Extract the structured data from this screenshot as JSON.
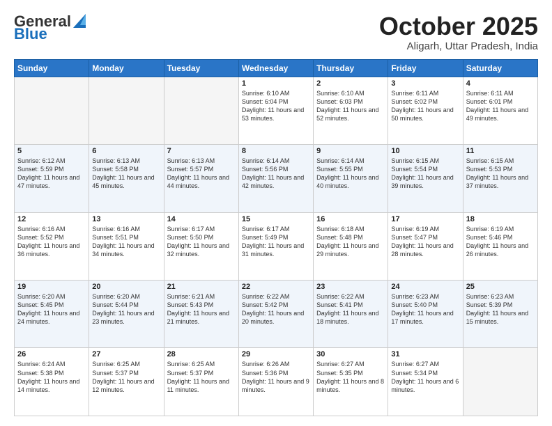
{
  "header": {
    "logo_general": "General",
    "logo_blue": "Blue",
    "month_title": "October 2025",
    "location": "Aligarh, Uttar Pradesh, India"
  },
  "days_of_week": [
    "Sunday",
    "Monday",
    "Tuesday",
    "Wednesday",
    "Thursday",
    "Friday",
    "Saturday"
  ],
  "weeks": [
    [
      {
        "day": "",
        "sunrise": "",
        "sunset": "",
        "daylight": ""
      },
      {
        "day": "",
        "sunrise": "",
        "sunset": "",
        "daylight": ""
      },
      {
        "day": "",
        "sunrise": "",
        "sunset": "",
        "daylight": ""
      },
      {
        "day": "1",
        "sunrise": "Sunrise: 6:10 AM",
        "sunset": "Sunset: 6:04 PM",
        "daylight": "Daylight: 11 hours and 53 minutes."
      },
      {
        "day": "2",
        "sunrise": "Sunrise: 6:10 AM",
        "sunset": "Sunset: 6:03 PM",
        "daylight": "Daylight: 11 hours and 52 minutes."
      },
      {
        "day": "3",
        "sunrise": "Sunrise: 6:11 AM",
        "sunset": "Sunset: 6:02 PM",
        "daylight": "Daylight: 11 hours and 50 minutes."
      },
      {
        "day": "4",
        "sunrise": "Sunrise: 6:11 AM",
        "sunset": "Sunset: 6:01 PM",
        "daylight": "Daylight: 11 hours and 49 minutes."
      }
    ],
    [
      {
        "day": "5",
        "sunrise": "Sunrise: 6:12 AM",
        "sunset": "Sunset: 5:59 PM",
        "daylight": "Daylight: 11 hours and 47 minutes."
      },
      {
        "day": "6",
        "sunrise": "Sunrise: 6:13 AM",
        "sunset": "Sunset: 5:58 PM",
        "daylight": "Daylight: 11 hours and 45 minutes."
      },
      {
        "day": "7",
        "sunrise": "Sunrise: 6:13 AM",
        "sunset": "Sunset: 5:57 PM",
        "daylight": "Daylight: 11 hours and 44 minutes."
      },
      {
        "day": "8",
        "sunrise": "Sunrise: 6:14 AM",
        "sunset": "Sunset: 5:56 PM",
        "daylight": "Daylight: 11 hours and 42 minutes."
      },
      {
        "day": "9",
        "sunrise": "Sunrise: 6:14 AM",
        "sunset": "Sunset: 5:55 PM",
        "daylight": "Daylight: 11 hours and 40 minutes."
      },
      {
        "day": "10",
        "sunrise": "Sunrise: 6:15 AM",
        "sunset": "Sunset: 5:54 PM",
        "daylight": "Daylight: 11 hours and 39 minutes."
      },
      {
        "day": "11",
        "sunrise": "Sunrise: 6:15 AM",
        "sunset": "Sunset: 5:53 PM",
        "daylight": "Daylight: 11 hours and 37 minutes."
      }
    ],
    [
      {
        "day": "12",
        "sunrise": "Sunrise: 6:16 AM",
        "sunset": "Sunset: 5:52 PM",
        "daylight": "Daylight: 11 hours and 36 minutes."
      },
      {
        "day": "13",
        "sunrise": "Sunrise: 6:16 AM",
        "sunset": "Sunset: 5:51 PM",
        "daylight": "Daylight: 11 hours and 34 minutes."
      },
      {
        "day": "14",
        "sunrise": "Sunrise: 6:17 AM",
        "sunset": "Sunset: 5:50 PM",
        "daylight": "Daylight: 11 hours and 32 minutes."
      },
      {
        "day": "15",
        "sunrise": "Sunrise: 6:17 AM",
        "sunset": "Sunset: 5:49 PM",
        "daylight": "Daylight: 11 hours and 31 minutes."
      },
      {
        "day": "16",
        "sunrise": "Sunrise: 6:18 AM",
        "sunset": "Sunset: 5:48 PM",
        "daylight": "Daylight: 11 hours and 29 minutes."
      },
      {
        "day": "17",
        "sunrise": "Sunrise: 6:19 AM",
        "sunset": "Sunset: 5:47 PM",
        "daylight": "Daylight: 11 hours and 28 minutes."
      },
      {
        "day": "18",
        "sunrise": "Sunrise: 6:19 AM",
        "sunset": "Sunset: 5:46 PM",
        "daylight": "Daylight: 11 hours and 26 minutes."
      }
    ],
    [
      {
        "day": "19",
        "sunrise": "Sunrise: 6:20 AM",
        "sunset": "Sunset: 5:45 PM",
        "daylight": "Daylight: 11 hours and 24 minutes."
      },
      {
        "day": "20",
        "sunrise": "Sunrise: 6:20 AM",
        "sunset": "Sunset: 5:44 PM",
        "daylight": "Daylight: 11 hours and 23 minutes."
      },
      {
        "day": "21",
        "sunrise": "Sunrise: 6:21 AM",
        "sunset": "Sunset: 5:43 PM",
        "daylight": "Daylight: 11 hours and 21 minutes."
      },
      {
        "day": "22",
        "sunrise": "Sunrise: 6:22 AM",
        "sunset": "Sunset: 5:42 PM",
        "daylight": "Daylight: 11 hours and 20 minutes."
      },
      {
        "day": "23",
        "sunrise": "Sunrise: 6:22 AM",
        "sunset": "Sunset: 5:41 PM",
        "daylight": "Daylight: 11 hours and 18 minutes."
      },
      {
        "day": "24",
        "sunrise": "Sunrise: 6:23 AM",
        "sunset": "Sunset: 5:40 PM",
        "daylight": "Daylight: 11 hours and 17 minutes."
      },
      {
        "day": "25",
        "sunrise": "Sunrise: 6:23 AM",
        "sunset": "Sunset: 5:39 PM",
        "daylight": "Daylight: 11 hours and 15 minutes."
      }
    ],
    [
      {
        "day": "26",
        "sunrise": "Sunrise: 6:24 AM",
        "sunset": "Sunset: 5:38 PM",
        "daylight": "Daylight: 11 hours and 14 minutes."
      },
      {
        "day": "27",
        "sunrise": "Sunrise: 6:25 AM",
        "sunset": "Sunset: 5:37 PM",
        "daylight": "Daylight: 11 hours and 12 minutes."
      },
      {
        "day": "28",
        "sunrise": "Sunrise: 6:25 AM",
        "sunset": "Sunset: 5:37 PM",
        "daylight": "Daylight: 11 hours and 11 minutes."
      },
      {
        "day": "29",
        "sunrise": "Sunrise: 6:26 AM",
        "sunset": "Sunset: 5:36 PM",
        "daylight": "Daylight: 11 hours and 9 minutes."
      },
      {
        "day": "30",
        "sunrise": "Sunrise: 6:27 AM",
        "sunset": "Sunset: 5:35 PM",
        "daylight": "Daylight: 11 hours and 8 minutes."
      },
      {
        "day": "31",
        "sunrise": "Sunrise: 6:27 AM",
        "sunset": "Sunset: 5:34 PM",
        "daylight": "Daylight: 11 hours and 6 minutes."
      },
      {
        "day": "",
        "sunrise": "",
        "sunset": "",
        "daylight": ""
      }
    ]
  ]
}
